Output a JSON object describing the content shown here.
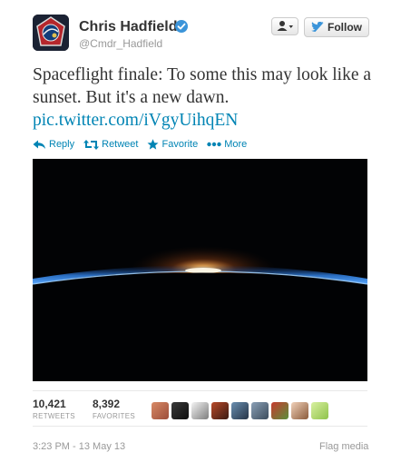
{
  "user": {
    "name": "Chris Hadfield",
    "handle": "@Cmdr_Hadfield",
    "verified_icon": "verified-badge-icon"
  },
  "header": {
    "follow_label": "Follow",
    "user_menu_icon": "person-dropdown-icon"
  },
  "tweet": {
    "text": "Spaceflight finale: To some this may look like a sunset. But it's a new dawn.",
    "link": "pic.twitter.com/iVgyUihqEN"
  },
  "actions": [
    {
      "label": "Reply",
      "icon": "reply-arrow-icon"
    },
    {
      "label": "Retweet",
      "icon": "retweet-icon"
    },
    {
      "label": "Favorite",
      "icon": "star-icon"
    },
    {
      "label": "More",
      "icon": "more-dots-icon"
    }
  ],
  "stats": {
    "retweets": {
      "value": "10,421",
      "label": "RETWEETS"
    },
    "favorites": {
      "value": "8,392",
      "label": "FAVORITES"
    }
  },
  "footer": {
    "timestamp": "3:23 PM - 13 May 13",
    "flag_media": "Flag media"
  },
  "colors": {
    "link": "#0084b4",
    "verified": "#3b94d9",
    "text": "#333333",
    "muted": "#999999"
  }
}
